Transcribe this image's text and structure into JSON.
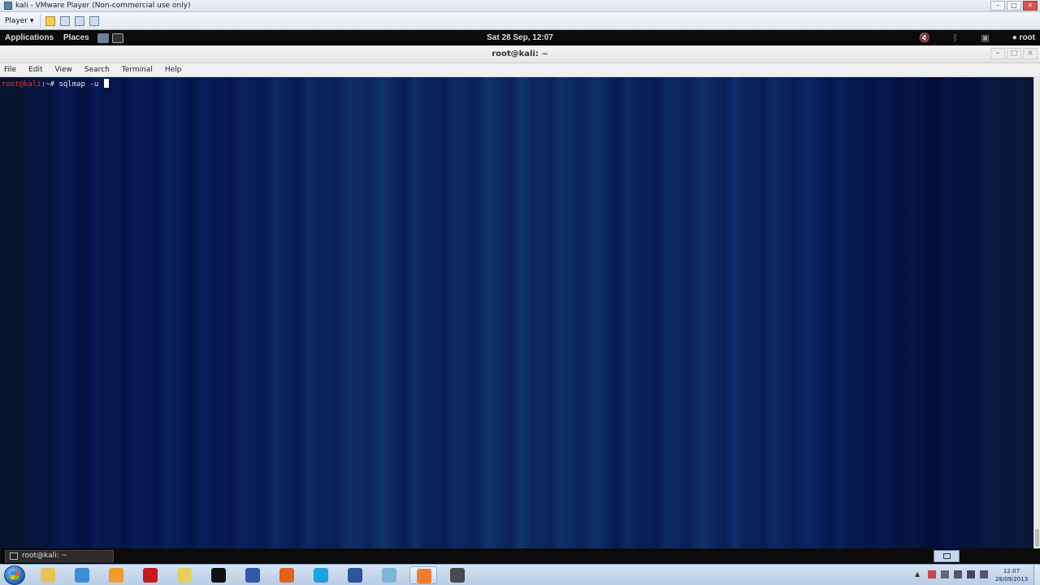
{
  "vmware": {
    "title": "kali - VMware Player (Non-commercial use only)",
    "player_menu": "Player ▾",
    "window_controls": [
      "–",
      "□",
      "✕"
    ]
  },
  "kali_panel": {
    "menus": [
      "Applications",
      "Places"
    ],
    "clock": "Sat 28 Sep, 12:07",
    "user": "root",
    "icons": [
      "volume-muted-icon",
      "bluetooth-icon",
      "network-icon",
      "user-icon"
    ]
  },
  "terminal": {
    "title": "root@kali: ~",
    "menu": [
      "File",
      "Edit",
      "View",
      "Search",
      "Terminal",
      "Help"
    ],
    "prompt_user": "root@kali",
    "prompt_rest": ":~# ",
    "command": "sqlmap -u ",
    "window_controls": [
      "–",
      "□",
      "✕"
    ]
  },
  "kali_bottom": {
    "task_label": "root@kali: ~"
  },
  "windows_taskbar": {
    "pinned_apps": [
      {
        "name": "explorer",
        "color": "#e8c45a"
      },
      {
        "name": "internet-explorer",
        "color": "#3a8fd8"
      },
      {
        "name": "media-player",
        "color": "#f29a2e"
      },
      {
        "name": "adobe-reader",
        "color": "#c8181c"
      },
      {
        "name": "file-manager",
        "color": "#e6cf5a"
      },
      {
        "name": "command-prompt",
        "color": "#111111"
      },
      {
        "name": "network-tool",
        "color": "#2f5aa8"
      },
      {
        "name": "firefox",
        "color": "#e2621b"
      },
      {
        "name": "skype",
        "color": "#1aa3e0"
      },
      {
        "name": "word",
        "color": "#2a5699"
      },
      {
        "name": "generic-app",
        "color": "#7cb6d8"
      },
      {
        "name": "vmware",
        "color": "#f07d2a"
      },
      {
        "name": "tool-app",
        "color": "#4a4a4a"
      }
    ],
    "time": "12:07",
    "date": "28/09/2013"
  }
}
